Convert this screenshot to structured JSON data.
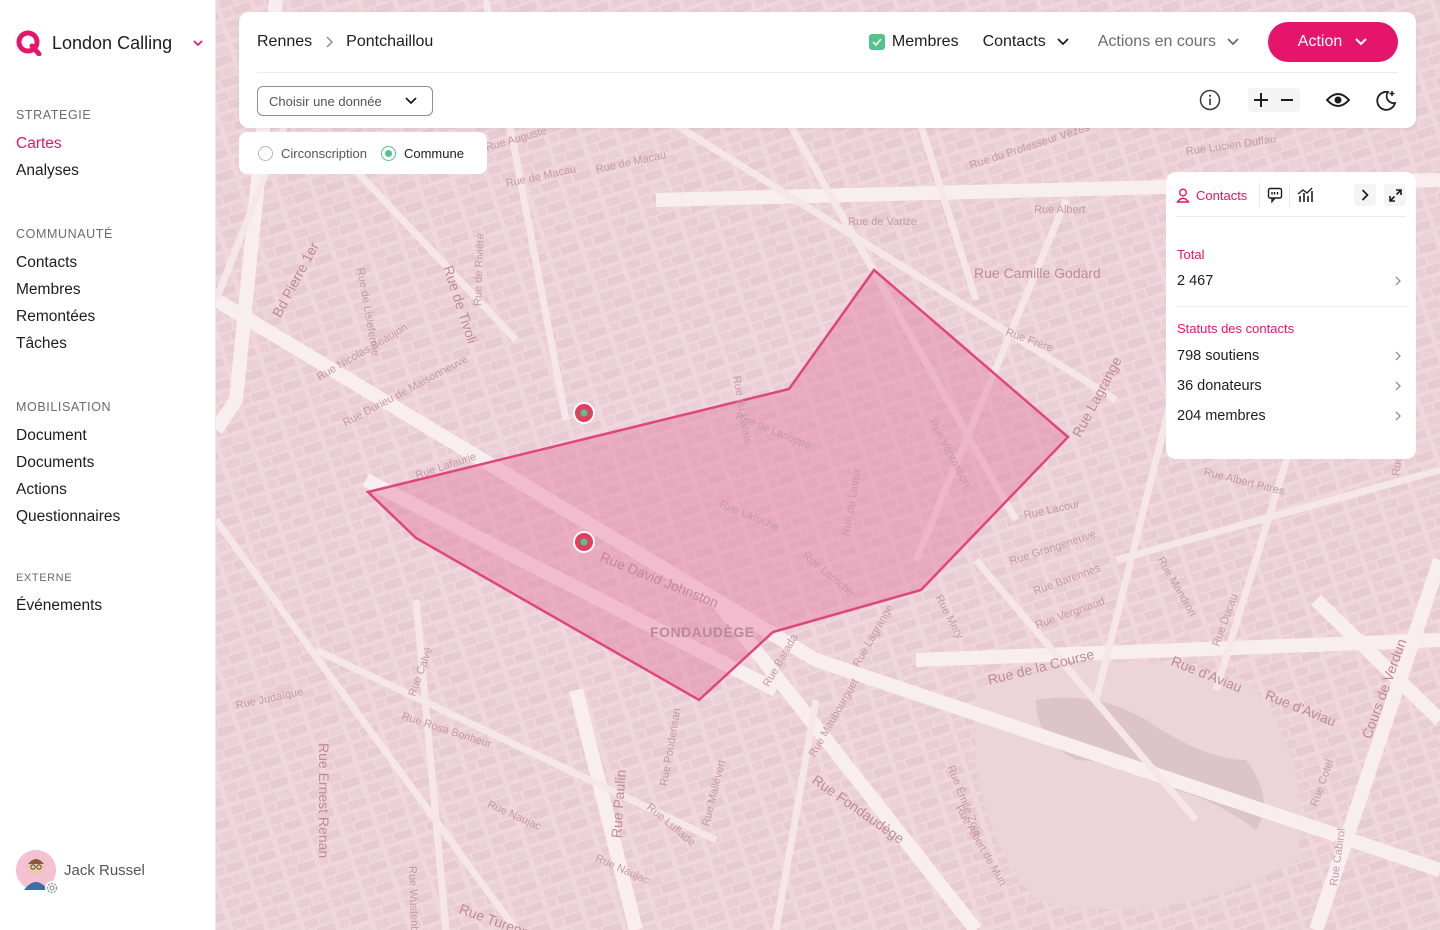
{
  "brand": {
    "name": "London Calling",
    "accent": "#e5156b"
  },
  "sidebar": {
    "sections": [
      {
        "title": "STRATEGIE",
        "items": [
          "Cartes",
          "Analyses"
        ]
      },
      {
        "title": "COMMUNAUTÉ",
        "items": [
          "Contacts",
          "Membres",
          "Remontées",
          "Tâches"
        ]
      },
      {
        "title": "MOBILISATION",
        "items": [
          "Document",
          "Documents",
          "Actions",
          "Questionnaires"
        ]
      },
      {
        "title": "EXTERNE",
        "items": [
          "Événements"
        ]
      }
    ],
    "active_item": "Cartes"
  },
  "user": {
    "name": "Jack Russel"
  },
  "header": {
    "breadcrumb": [
      "Rennes",
      "Pontchaillou"
    ],
    "membres_label": "Membres",
    "contacts_label": "Contacts",
    "actions_label": "Actions en cours",
    "action_button": "Action",
    "select_placeholder": "Choisir une donnée"
  },
  "layer_toggle": {
    "options": [
      "Circonscription",
      "Commune"
    ],
    "selected": "Commune"
  },
  "stats": {
    "tab_label": "Contacts",
    "total_label": "Total",
    "total_value": "2 467",
    "status_label": "Statuts des contacts",
    "rows": [
      "798 soutiens",
      "36 donateurs",
      "204 membres"
    ]
  },
  "map": {
    "district_label": "FONDAUDÈGE",
    "streets": [
      "Rue David Johnston",
      "Rue de la Course",
      "Rue Fondaudège",
      "Rue Camille Godard",
      "Rue d'Aviau",
      "Rue d'Aviau",
      "Cours de Verdun",
      "Rue Mandron",
      "Rue Lagrange",
      "Bd Pierre 1er",
      "Rue de Tivoli",
      "Rue de Macau",
      "Rue de Macau",
      "Rue du Professeur Vèzes",
      "Rue de Varize",
      "Rue Albert",
      "Rue Lucien Duffau",
      "Rue de Laseppe",
      "Rue Laroche",
      "Rue Laroche",
      "Rue du Lavoir",
      "Rue Vanrasson",
      "Rue Nicolas Beaujon",
      "Rue Durieu de Maisonneuve",
      "Rue Ernest Renan",
      "Rue Rosa Bonheur",
      "Rue Naujac",
      "Rue Naujac",
      "Rue Paulin",
      "Rue Lacour",
      "Rue Grangeneuve",
      "Rue Barennes",
      "Rue Vergniaud",
      "Rue Ducau",
      "Rue Émile Zola",
      "Rue Albert de Mun",
      "Rue Maubourguet",
      "Rue Mery",
      "Rue Barada",
      "Rue Frère",
      "Rue Calvé",
      "Rue Lafaurie",
      "Rue Judaïque",
      "Rue du Palais",
      "Rue de Rivière",
      "Rue de Lisleferme",
      "Rue Albert Pitres",
      "Rue Dandicolle",
      "Rue Lagrange",
      "Rue Mallévert",
      "Rue Poudensan",
      "Rue Luflade",
      "Rue Wustenberg",
      "Rue Turenne",
      "Rue Cabirol",
      "Rue Cotel",
      "Rue Auguste"
    ]
  }
}
